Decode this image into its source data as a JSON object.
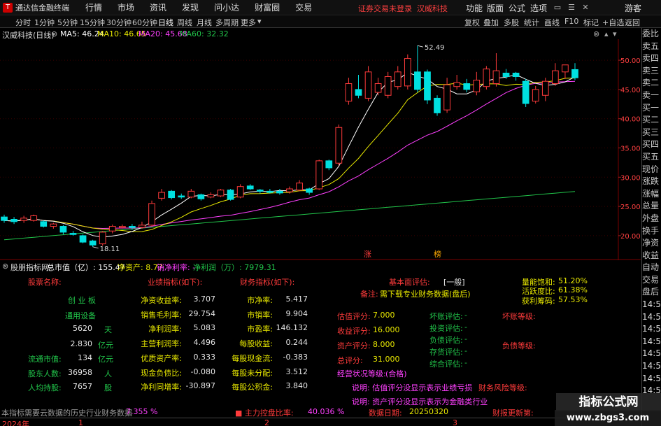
{
  "titlebar": {
    "app_name": "通达信金融终端",
    "menus": [
      "行情",
      "市场",
      "资讯",
      "发现",
      "问小达",
      "财富圈",
      "交易"
    ],
    "notice": "证券交易未登录",
    "stock_name": "汉威科技",
    "right_menus": [
      "功能",
      "版面",
      "公式",
      "选项"
    ],
    "user": "游客"
  },
  "toolbar": {
    "periods": [
      "分时",
      "1分钟",
      "5分钟",
      "15分钟",
      "30分钟",
      "60分钟",
      "日线",
      "周线",
      "月线",
      "多周期",
      "更多"
    ],
    "active_period": "日线",
    "right_items": [
      "复权",
      "叠加",
      "多股",
      "统计",
      "画线",
      "F10",
      "标记",
      "+自选",
      "返回"
    ]
  },
  "chart_header": {
    "title": "汉威科技(日线)",
    "ma5": "MA5: 46.24",
    "ma10": "MA10: 46.65",
    "ma20": "MA20: 45.68",
    "ma60": "MA60: 32.32"
  },
  "chart_data": {
    "type": "candlestick",
    "title": "汉威科技(日线)",
    "ylim": [
      17,
      53
    ],
    "yticks": [
      20,
      25,
      30,
      35,
      40,
      45,
      50
    ],
    "ytick_labels": [
      "20.00",
      "25.00",
      "30.00",
      "35.00",
      "40.00",
      "45.00",
      "50.00"
    ],
    "candles": [
      {
        "o": 23.2,
        "c": 22.6,
        "h": 23.6,
        "l": 22.2
      },
      {
        "o": 22.8,
        "c": 22.4,
        "h": 23.2,
        "l": 22.0
      },
      {
        "o": 22.6,
        "c": 23.0,
        "h": 23.4,
        "l": 22.2
      },
      {
        "o": 22.6,
        "c": 23.4,
        "h": 23.6,
        "l": 22.4
      },
      {
        "o": 22.4,
        "c": 21.6,
        "h": 22.6,
        "l": 21.4
      },
      {
        "o": 21.6,
        "c": 22.0,
        "h": 22.2,
        "l": 21.2
      },
      {
        "o": 21.6,
        "c": 20.6,
        "h": 21.8,
        "l": 20.2
      },
      {
        "o": 20.4,
        "c": 20.2,
        "h": 20.8,
        "l": 20.0
      },
      {
        "o": 20.0,
        "c": 18.9,
        "h": 20.2,
        "l": 18.7
      },
      {
        "o": 19.1,
        "c": 18.4,
        "h": 19.3,
        "l": 18.1
      },
      {
        "o": 18.6,
        "c": 20.6,
        "h": 20.8,
        "l": 18.3
      },
      {
        "o": 20.8,
        "c": 21.6,
        "h": 21.9,
        "l": 20.4
      },
      {
        "o": 21.4,
        "c": 21.6,
        "h": 21.9,
        "l": 21.2
      },
      {
        "o": 21.6,
        "c": 21.4,
        "h": 22.0,
        "l": 21.0
      },
      {
        "o": 21.4,
        "c": 21.8,
        "h": 22.4,
        "l": 21.2
      },
      {
        "o": 21.8,
        "c": 25.5,
        "h": 26.0,
        "l": 21.6
      },
      {
        "o": 26.4,
        "c": 27.4,
        "h": 28.0,
        "l": 26.0
      },
      {
        "o": 27.6,
        "c": 26.5,
        "h": 27.8,
        "l": 26.2
      },
      {
        "o": 26.8,
        "c": 26.6,
        "h": 27.2,
        "l": 26.3
      },
      {
        "o": 26.6,
        "c": 27.6,
        "h": 28.0,
        "l": 26.4
      },
      {
        "o": 27.0,
        "c": 26.3,
        "h": 27.2,
        "l": 26.0
      },
      {
        "o": 26.6,
        "c": 27.0,
        "h": 27.4,
        "l": 26.4
      },
      {
        "o": 26.8,
        "c": 27.8,
        "h": 28.0,
        "l": 26.6
      },
      {
        "o": 27.8,
        "c": 26.2,
        "h": 28.0,
        "l": 26.0
      },
      {
        "o": 26.6,
        "c": 28.4,
        "h": 28.8,
        "l": 26.4
      },
      {
        "o": 28.5,
        "c": 28.0,
        "h": 28.8,
        "l": 27.8
      },
      {
        "o": 27.8,
        "c": 27.6,
        "h": 28.0,
        "l": 27.2
      },
      {
        "o": 27.6,
        "c": 27.4,
        "h": 28.0,
        "l": 27.2
      },
      {
        "o": 27.6,
        "c": 27.3,
        "h": 28.0,
        "l": 27.0
      },
      {
        "o": 27.5,
        "c": 28.0,
        "h": 28.4,
        "l": 27.2
      },
      {
        "o": 27.8,
        "c": 29.0,
        "h": 29.5,
        "l": 27.6
      },
      {
        "o": 28.0,
        "c": 27.4,
        "h": 28.2,
        "l": 27.0
      },
      {
        "o": 28.0,
        "c": 32.8,
        "h": 33.0,
        "l": 27.8
      },
      {
        "o": 32.8,
        "c": 31.6,
        "h": 33.0,
        "l": 31.2
      },
      {
        "o": 32.4,
        "c": 38.5,
        "h": 39.0,
        "l": 32.0
      },
      {
        "o": 43.0,
        "c": 46.0,
        "h": 47.0,
        "l": 42.4
      },
      {
        "o": 45.0,
        "c": 44.0,
        "h": 47.5,
        "l": 43.5
      },
      {
        "o": 43.5,
        "c": 48.0,
        "h": 49.0,
        "l": 43.0
      },
      {
        "o": 44.5,
        "c": 46.0,
        "h": 47.0,
        "l": 44.0
      },
      {
        "o": 44.0,
        "c": 47.2,
        "h": 48.0,
        "l": 43.5
      },
      {
        "o": 45.5,
        "c": 48.0,
        "h": 49.0,
        "l": 45.0
      },
      {
        "o": 45.6,
        "c": 50.3,
        "h": 51.0,
        "l": 45.0
      },
      {
        "o": 48.0,
        "c": 45.0,
        "h": 52.5,
        "l": 44.5
      },
      {
        "o": 48.0,
        "c": 43.2,
        "h": 48.4,
        "l": 42.5
      },
      {
        "o": 43.5,
        "c": 41.0,
        "h": 44.0,
        "l": 40.5
      },
      {
        "o": 41.5,
        "c": 45.8,
        "h": 47.0,
        "l": 41.0
      },
      {
        "o": 45.5,
        "c": 46.2,
        "h": 47.5,
        "l": 45.0
      },
      {
        "o": 46.0,
        "c": 45.0,
        "h": 46.8,
        "l": 44.5
      },
      {
        "o": 44.6,
        "c": 46.6,
        "h": 48.0,
        "l": 44.0
      },
      {
        "o": 45.5,
        "c": 48.5,
        "h": 49.0,
        "l": 45.0
      },
      {
        "o": 46.0,
        "c": 48.2,
        "h": 51.2,
        "l": 45.5
      },
      {
        "o": 47.8,
        "c": 47.2,
        "h": 48.5,
        "l": 46.8
      },
      {
        "o": 47.8,
        "c": 47.2,
        "h": 48.0,
        "l": 46.5
      },
      {
        "o": 46.4,
        "c": 42.6,
        "h": 46.8,
        "l": 42.0
      },
      {
        "o": 43.0,
        "c": 45.0,
        "h": 45.6,
        "l": 42.6
      },
      {
        "o": 44.0,
        "c": 46.4,
        "h": 47.0,
        "l": 43.0
      },
      {
        "o": 46.0,
        "c": 48.2,
        "h": 49.5,
        "l": 45.6
      },
      {
        "o": 48.0,
        "c": 49.2,
        "h": 49.2,
        "l": 46.8
      },
      {
        "o": 48.4,
        "c": 47.0,
        "h": 49.5,
        "l": 46.6
      }
    ],
    "annotations": [
      {
        "label": "52.49",
        "value": 52.49
      },
      {
        "label": "18.11",
        "value": 18.11
      },
      {
        "label": "涨",
        "value": null
      },
      {
        "label": "榜",
        "value": null
      }
    ],
    "grid": true
  },
  "right_panel": {
    "items": [
      "委比",
      "卖五",
      "卖四",
      "卖三",
      "卖二",
      "卖一",
      "买一",
      "买二",
      "买三",
      "买四",
      "买五",
      "现价",
      "涨跌",
      "涨幅",
      "总量",
      "外盘",
      "换手",
      "净资",
      "收益",
      "自动",
      "交易",
      "盘后",
      "14:5",
      "14:5",
      "14:5",
      "14:5",
      "14:5",
      "14:5",
      "14:5",
      "14:5"
    ]
  },
  "bottom_header": {
    "title": "股朋指标网",
    "total_value": "总市值（亿）: 155.47",
    "net_assets": "净资产: 8.77",
    "net_margin": "销净利率: -",
    "net_profit": "净利润（万）: 7979.31"
  },
  "fundamentals": {
    "col1_header": "股票名称:",
    "board": "创 业 板",
    "industry": "通用设备",
    "days_value": "5620",
    "days_unit": "天",
    "shares_value": "2.830",
    "shares_unit": "亿元",
    "float_label": "流通市值:",
    "float_value": "134",
    "float_unit": "亿元",
    "holders_label": "股东人数:",
    "holders_value": "36958",
    "holders_unit": "人",
    "avg_label": "人均持股:",
    "avg_value": "7657",
    "avg_unit": "股",
    "col2_header": "业绩指标(如下):",
    "col2": [
      {
        "k": "净资收益率:",
        "v": "3.707"
      },
      {
        "k": "销售毛利率:",
        "v": "29.754"
      },
      {
        "k": "净利润率:",
        "v": "5.083"
      },
      {
        "k": "主营利润率:",
        "v": "4.496"
      },
      {
        "k": "优质资产率:",
        "v": "0.333"
      },
      {
        "k": "现金负债比:",
        "v": "-0.080"
      },
      {
        "k": "净利同增率:",
        "v": "-30.897"
      }
    ],
    "col3_header": "财务指标(如下):",
    "col3": [
      {
        "k": "市净率:",
        "v": "5.417"
      },
      {
        "k": "市销率:",
        "v": "9.904"
      },
      {
        "k": "市盈率:",
        "v": "146.132"
      },
      {
        "k": "每股收益:",
        "v": "0.244"
      },
      {
        "k": "每股现金流:",
        "v": "-0.383"
      },
      {
        "k": "每股未分配:",
        "v": "3.512"
      },
      {
        "k": "每股公积金:",
        "v": "3.840"
      }
    ],
    "eval_label": "基本面评估:",
    "eval_value": "[一般]",
    "remark_label": "备注:",
    "remark_value": "需下载专业财务数据(盘后)",
    "score_left": [
      {
        "k": "估值评分:",
        "v": "7.000"
      },
      {
        "k": "收益评分:",
        "v": "16.000"
      },
      {
        "k": "资产评分:",
        "v": "8.000"
      },
      {
        "k": "总评分:",
        "v": "31.000"
      }
    ],
    "score_right": [
      {
        "k": "坏账评估:",
        "v": "-"
      },
      {
        "k": "投资评估:",
        "v": "-"
      },
      {
        "k": "负债评估:",
        "v": "-"
      },
      {
        "k": "存货评估:",
        "v": "-"
      },
      {
        "k": "综合评估:",
        "v": "-"
      }
    ],
    "bad_debt_level": "坏账等级:",
    "debt_level": "负债等级:",
    "status_label": "经营状况等级:",
    "status_value": "(合格)",
    "note1": "说明: 估值评分没显示表示业绩亏损",
    "note2": "说明: 资产评分没显示表示为金融类行业",
    "fin_risk": "财务风险等级:",
    "volume_sat_label": "量能饱和:",
    "volume_sat_value": "51.20%",
    "activity_label": "活跃度比:",
    "activity_value": "61.38%",
    "profit_chip_label": "获利筹码:",
    "profit_chip_value": "57.53%",
    "footer_note": "本指标需要云数据的历史行业财务数据",
    "footer_pct": "7.355 %",
    "main_ctrl_label": "主力控盘比率:",
    "main_ctrl_value": "40.036 %",
    "date_label": "数据日期:",
    "date_value": "20250320",
    "fin_update": "财报更新第:"
  },
  "timeline": {
    "year": "2024年",
    "marks": [
      "1",
      "2",
      "3"
    ]
  },
  "watermark": {
    "line1": "指标公式网",
    "line2": "www.zbgs3.com"
  },
  "colors": {
    "up": "#ff3b3b",
    "down": "#00e0e0",
    "ma5": "#ffffff",
    "ma10": "#e8e800",
    "ma20": "#ff40ff",
    "ma60": "#21c44a"
  }
}
